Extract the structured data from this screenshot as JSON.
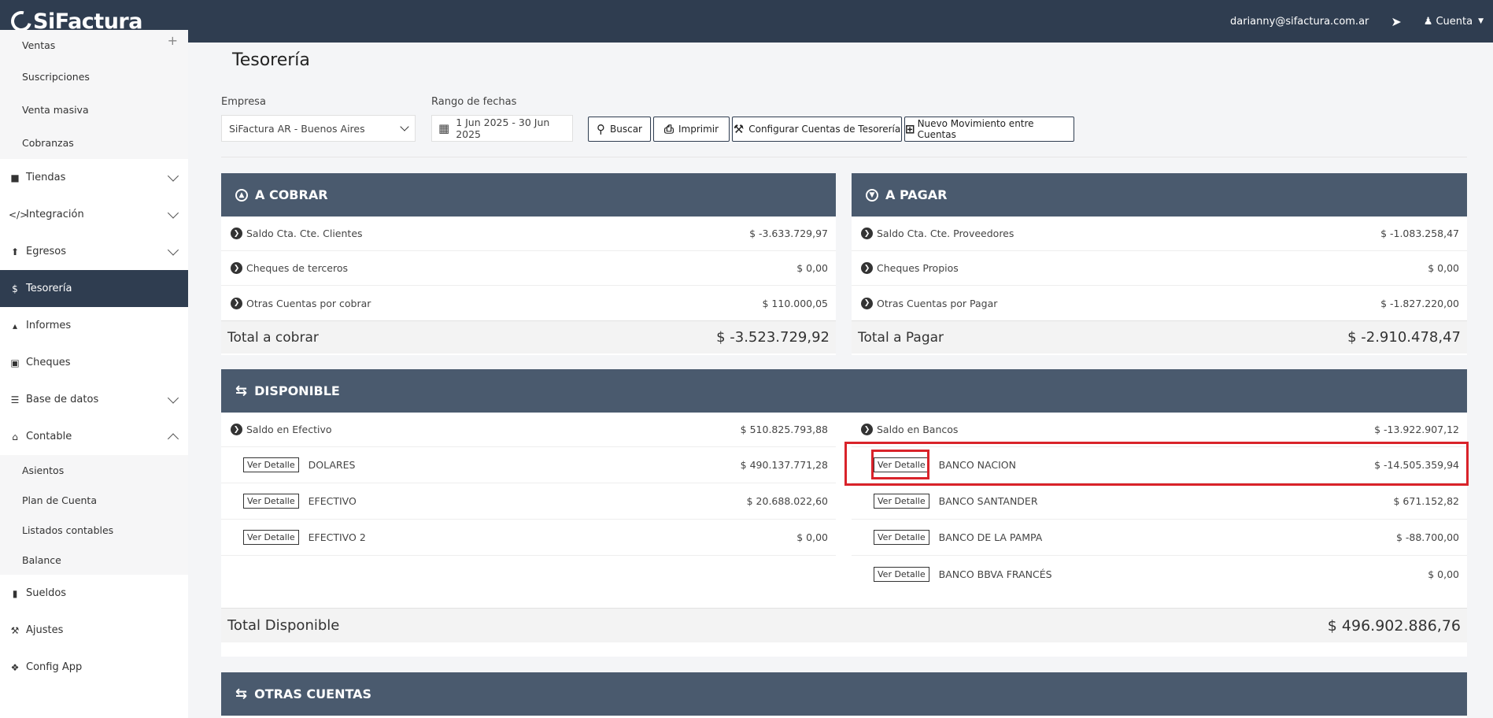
{
  "brand": "SiFactura",
  "user_email": "darianny@sifactura.com.ar",
  "account_label": "Cuenta",
  "sidebar": {
    "top_sub": [
      {
        "label": "Ventas"
      },
      {
        "label": "Suscripciones"
      },
      {
        "label": "Venta masiva"
      },
      {
        "label": "Cobranzas"
      }
    ],
    "items": [
      {
        "label": "Tiendas",
        "icon": "shopping-bag-icon"
      },
      {
        "label": "Integración",
        "icon": "code-icon"
      },
      {
        "label": "Egresos",
        "icon": "upload-icon"
      },
      {
        "label": "Tesorería",
        "icon": "dollar-icon"
      },
      {
        "label": "Informes",
        "icon": "area-chart-icon"
      },
      {
        "label": "Cheques",
        "icon": "credit-card-icon"
      },
      {
        "label": "Base de datos",
        "icon": "database-icon"
      },
      {
        "label": "Contable",
        "icon": "bank-icon"
      }
    ],
    "contable_sub": [
      {
        "label": "Asientos"
      },
      {
        "label": "Plan de Cuenta"
      },
      {
        "label": "Listados contables"
      },
      {
        "label": "Balance"
      }
    ],
    "bottom": [
      {
        "label": "Sueldos",
        "icon": "book-icon"
      },
      {
        "label": "Ajustes",
        "icon": "wrench-icon"
      },
      {
        "label": "Config App",
        "icon": "cubes-icon"
      }
    ]
  },
  "page_title": "Tesorería",
  "filters": {
    "empresa_label": "Empresa",
    "empresa_value": "SiFactura AR - Buenos Aires",
    "rango_label": "Rango de fechas",
    "rango_value": "1 Jun 2025 - 30 Jun 2025"
  },
  "buttons": {
    "buscar": "Buscar",
    "imprimir": "Imprimir",
    "configurar": "Configurar Cuentas de Tesorería",
    "nuevo": "Nuevo Movimiento entre Cuentas"
  },
  "a_cobrar": {
    "title": "A COBRAR",
    "rows": [
      {
        "label": "Saldo Cta. Cte. Clientes",
        "amount": "$ -3.633.729,97"
      },
      {
        "label": "Cheques de terceros",
        "amount": "$ 0,00"
      },
      {
        "label": "Otras Cuentas por cobrar",
        "amount": "$ 110.000,05"
      }
    ],
    "total_label": "Total a cobrar",
    "total_amount": "$ -3.523.729,92"
  },
  "a_pagar": {
    "title": "A PAGAR",
    "rows": [
      {
        "label": "Saldo Cta. Cte. Proveedores",
        "amount": "$ -1.083.258,47"
      },
      {
        "label": "Cheques Propios",
        "amount": "$ 0,00"
      },
      {
        "label": "Otras Cuentas por Pagar",
        "amount": "$ -1.827.220,00"
      }
    ],
    "total_label": "Total a Pagar",
    "total_amount": "$ -2.910.478,47"
  },
  "disponible": {
    "title": "DISPONIBLE",
    "efectivo_label": "Saldo en Efectivo",
    "efectivo_amount": "$ 510.825.793,88",
    "efectivo_rows": [
      {
        "name": "DOLARES",
        "amount": "$ 490.137.771,28"
      },
      {
        "name": "EFECTIVO",
        "amount": "$ 20.688.022,60"
      },
      {
        "name": "EFECTIVO 2",
        "amount": "$ 0,00"
      }
    ],
    "bancos_label": "Saldo en Bancos",
    "bancos_amount": "$ -13.922.907,12",
    "bancos_rows": [
      {
        "name": "BANCO NACION",
        "amount": "$ -14.505.359,94"
      },
      {
        "name": "BANCO SANTANDER",
        "amount": "$ 671.152,82"
      },
      {
        "name": "BANCO DE LA PAMPA",
        "amount": "$ -88.700,00"
      },
      {
        "name": "BANCO BBVA FRANCÉS",
        "amount": "$ 0,00"
      }
    ],
    "ver_detalle": "Ver Detalle",
    "total_label": "Total Disponible",
    "total_amount": "$ 496.902.886,76"
  },
  "otras": {
    "title": "OTRAS CUENTAS"
  },
  "colors": {
    "navbar": "#2f3d50",
    "panel_header": "#4a5a6e",
    "highlight": "#d9232a"
  }
}
